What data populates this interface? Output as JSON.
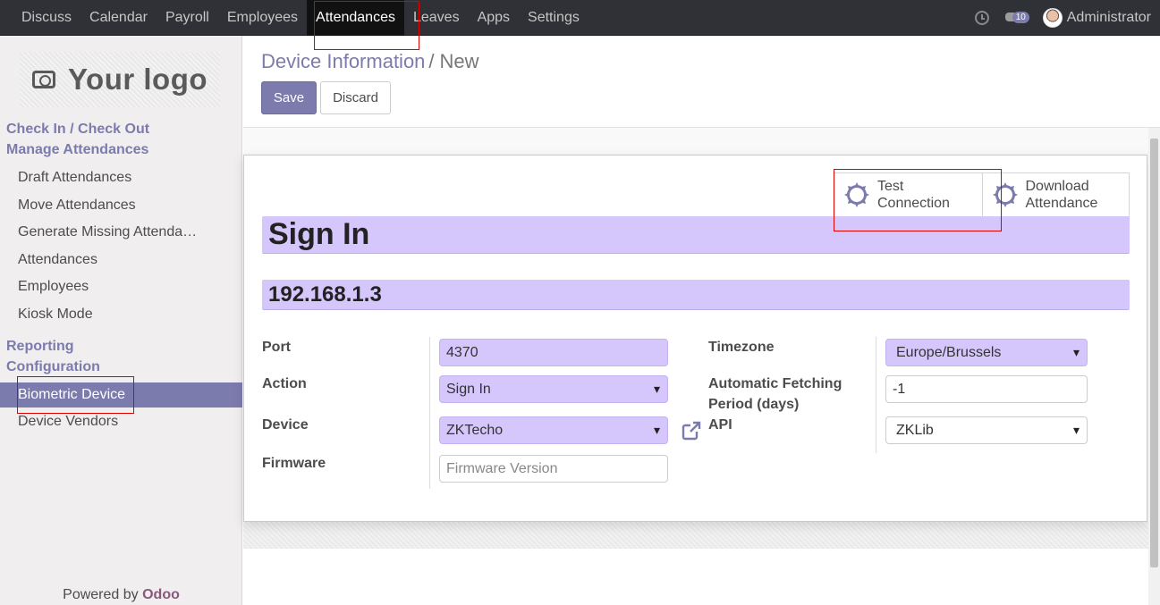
{
  "topbar": {
    "menu": [
      "Discuss",
      "Calendar",
      "Payroll",
      "Employees",
      "Attendances",
      "Leaves",
      "Apps",
      "Settings"
    ],
    "active_index": 4,
    "chat_count": "10",
    "user": "Administrator"
  },
  "sidebar": {
    "logo_text": "Your logo",
    "sections": {
      "check_in_out": "Check In / Check Out",
      "manage": "Manage Attendances",
      "reporting": "Reporting",
      "configuration": "Configuration"
    },
    "manage_items": [
      "Draft Attendances",
      "Move Attendances",
      "Generate Missing Attenda…",
      "Attendances",
      "Employees",
      "Kiosk Mode"
    ],
    "config_items": [
      "Biometric Device",
      "Device Vendors"
    ],
    "powered_by": "Powered by",
    "powered_brand": "Odoo"
  },
  "control": {
    "breadcrumb_parent": "Device Information",
    "breadcrumb_sep": "/",
    "breadcrumb_current": "New",
    "save": "Save",
    "discard": "Discard"
  },
  "form": {
    "buttons": {
      "test_line1": "Test",
      "test_line2": "Connection",
      "download_line1": "Download",
      "download_line2": "Attendance"
    },
    "name": "Sign In",
    "ip": "192.168.1.3",
    "left": {
      "port_label": "Port",
      "port_value": "4370",
      "action_label": "Action",
      "action_value": "Sign In",
      "device_label": "Device",
      "device_value": "ZKTecho",
      "firmware_label": "Firmware",
      "firmware_placeholder": "Firmware Version"
    },
    "right": {
      "timezone_label": "Timezone",
      "timezone_value": "Europe/Brussels",
      "fetch_label_1": "Automatic Fetching",
      "fetch_label_2": "Period (days)",
      "fetch_value": "-1",
      "api_label": "API",
      "api_value": "ZKLib"
    }
  },
  "colors": {
    "accent": "#7c7bad",
    "required_field": "#d5c6fb",
    "highlight": "#e00000",
    "navbar": "#2f3136"
  }
}
